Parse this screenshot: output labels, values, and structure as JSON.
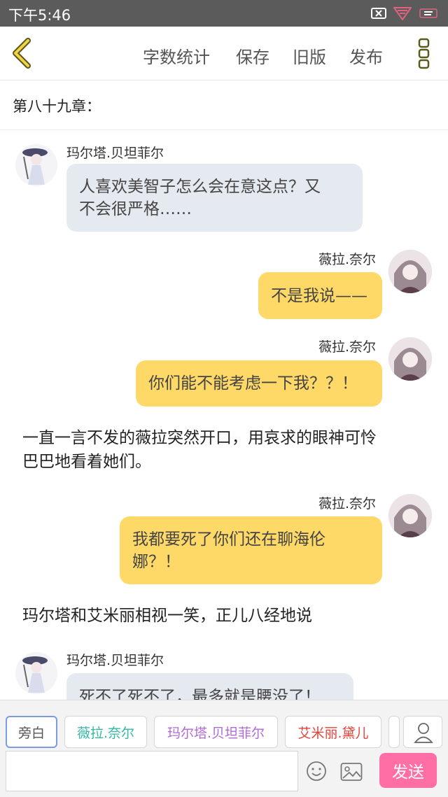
{
  "status_bar": {
    "time": "下午5:46",
    "icons": [
      "notification-x-icon",
      "signal-icon",
      "battery-icon"
    ]
  },
  "header": {
    "back_icon": "chevron-left-icon",
    "word_count": "字数统计",
    "save": "保存",
    "old_version": "旧版",
    "publish": "发布",
    "more_icon": "vertical-dots-icon"
  },
  "chapter_title": "第八十九章：",
  "messages": [
    {
      "type": "left",
      "speaker": "玛尔塔.贝坦菲尔",
      "text_lines": [
        "人喜欢美智子怎么会在意这点？又",
        "不会很严格……"
      ]
    },
    {
      "type": "right",
      "speaker": "薇拉.奈尔",
      "text": "不是我说——"
    },
    {
      "type": "right",
      "speaker": "薇拉.奈尔",
      "text": "你们能不能考虑一下我？？！"
    },
    {
      "type": "narration",
      "text_lines": [
        "一直一言不发的薇拉突然开口，用哀求的眼神可怜",
        "巴巴地看着她们。"
      ]
    },
    {
      "type": "right",
      "speaker": "薇拉.奈尔",
      "text_lines": [
        "我都要死了你们还在聊海伦",
        "娜？！"
      ]
    },
    {
      "type": "narration",
      "text": "玛尔塔和艾米丽相视一笑，正儿八经地说"
    },
    {
      "type": "left",
      "speaker": "玛尔塔.贝坦菲尔",
      "text": "死不了死不了，最多就是腰没了！"
    }
  ],
  "bottom": {
    "chips": [
      {
        "label": "旁白",
        "color": "#555555"
      },
      {
        "label": "薇拉.奈尔",
        "color": "#35b8a3"
      },
      {
        "label": "玛尔塔.贝坦菲尔",
        "color": "#b26ad6"
      },
      {
        "label": "艾米丽.黛儿",
        "color": "#e8413a"
      }
    ],
    "input_value": "",
    "send_label": "发送",
    "colors": {
      "send_bg": "#ff6fa6"
    }
  }
}
